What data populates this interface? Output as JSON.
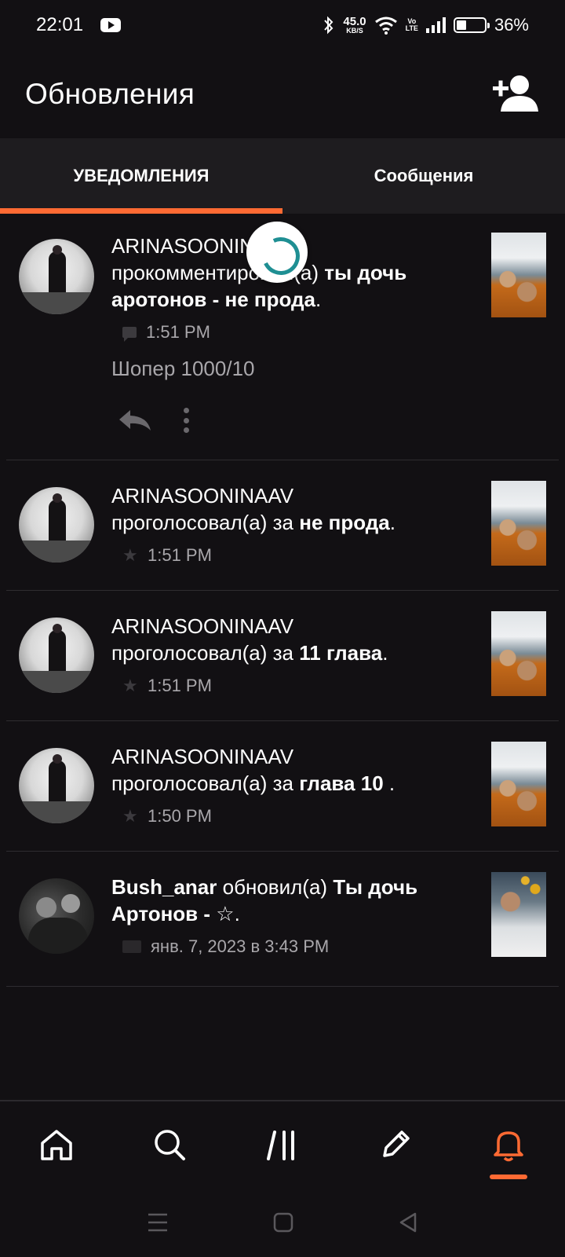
{
  "status_bar": {
    "time": "22:01",
    "net_speed": "45.0",
    "net_unit": "KB/S",
    "volte_top": "Vo",
    "volte_bottom": "LTE",
    "battery": "36%"
  },
  "header": {
    "title": "Обновления",
    "add_icon": "add-friend-icon"
  },
  "tabs": [
    {
      "label": "УВЕДОМЛЕНИЯ",
      "active": true
    },
    {
      "label": "Сообщения",
      "active": false
    }
  ],
  "notifications": [
    {
      "user": "ARINASOONINAAV",
      "action": "прокомментировал(а)",
      "target": "ты дочь аротонов - не прода",
      "tail": ".",
      "time": "1:51 PM",
      "meta_icon": "comment-icon",
      "comment": "Шопер 1000/10"
    },
    {
      "user": "ARINASOONINAAV",
      "action": "проголосовал(а) за",
      "target": "не прода",
      "tail": ".",
      "time": "1:51 PM",
      "meta_icon": "star-icon"
    },
    {
      "user": "ARINASOONINAAV",
      "action": "проголосовал(а) за",
      "target": "11 глава",
      "tail": ".",
      "time": "1:51 PM",
      "meta_icon": "star-icon"
    },
    {
      "user": "ARINASOONINAAV",
      "action": "проголосовал(а) за",
      "target": "глава 10",
      "tail": " .",
      "time": "1:50 PM",
      "meta_icon": "star-icon"
    },
    {
      "user": "Bush_anar",
      "action": "обновил(а)",
      "target": "Ты дочь Артонов - ☆",
      "tail": ".",
      "time": "янв. 7, 2023 в 3:43 PM",
      "meta_icon": "book-icon"
    }
  ],
  "bottom_nav": [
    "home-icon",
    "search-icon",
    "library-icon",
    "write-icon",
    "notifications-icon"
  ],
  "colors": {
    "accent": "#ff6a33",
    "background": "#121013",
    "tabbar": "#1e1c1f",
    "spinner": "#1f8f93"
  }
}
